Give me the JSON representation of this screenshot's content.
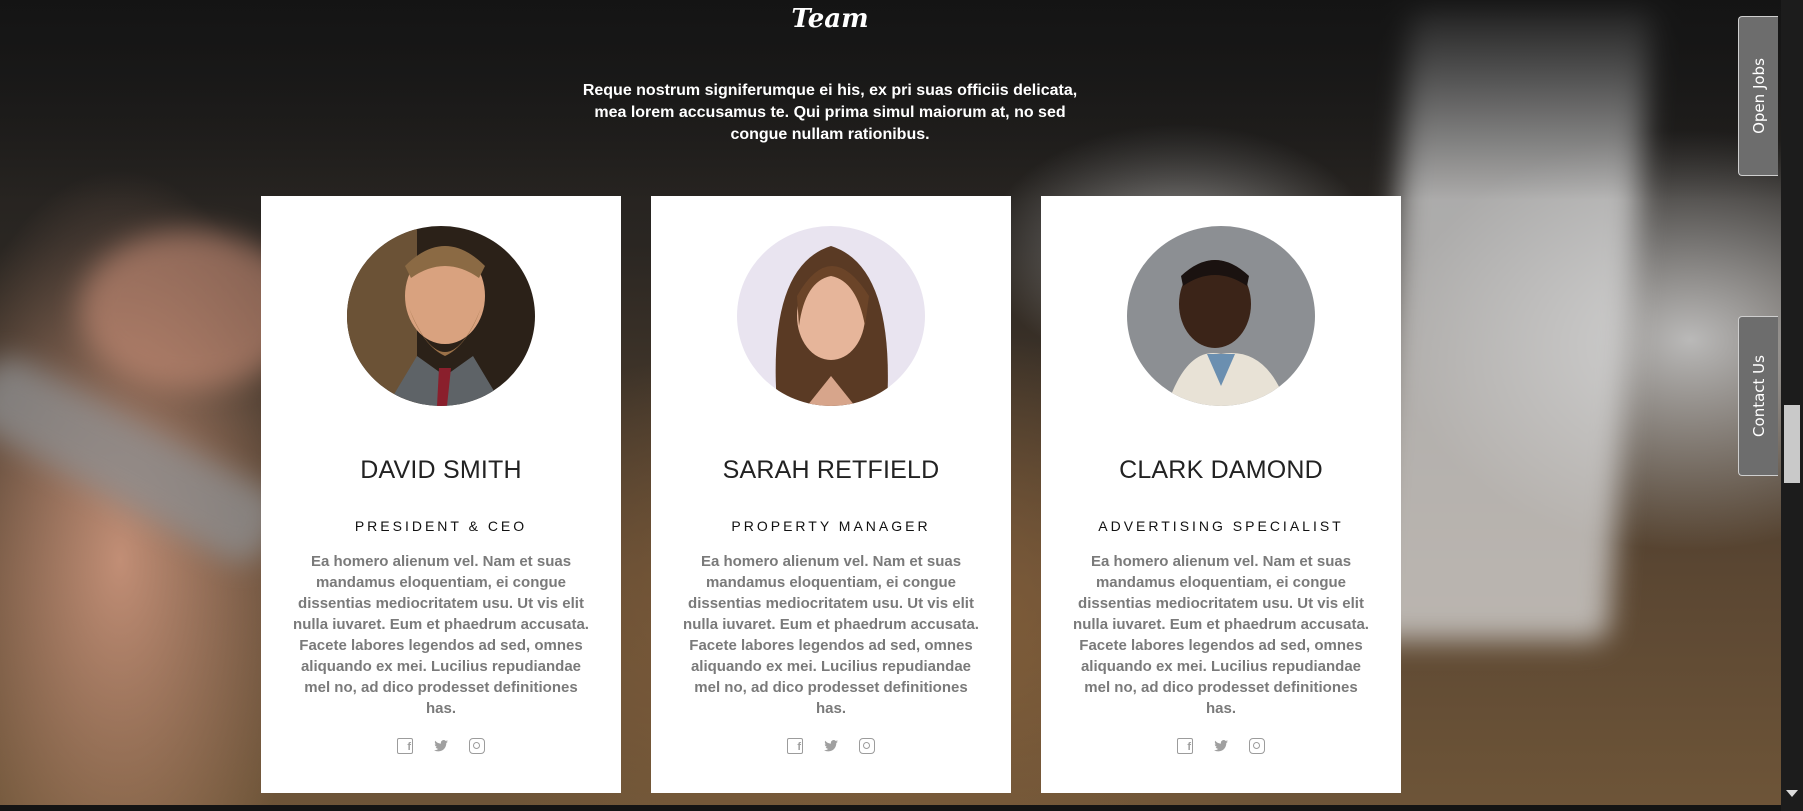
{
  "section": {
    "heading": "Team",
    "intro": "Reque nostrum signiferumque ei his, ex pri suas officiis delicata, mea lorem accusamus te. Qui prima simul maiorum at, no sed congue nullam rationibus."
  },
  "team": [
    {
      "name": "DAVID SMITH",
      "role": "PRESIDENT & CEO",
      "bio": "Ea homero alienum vel. Nam et suas mandamus eloquentiam, ei congue dissentias mediocritatem usu. Ut vis elit nulla iuvaret. Eum et phaedrum accusata. Facete labores legendos ad sed, omnes aliquando ex mei. Lucilius repudiandae mel no, ad dico prodesset definitiones has.",
      "social": [
        "facebook-icon",
        "twitter-icon",
        "instagram-icon"
      ]
    },
    {
      "name": "SARAH RETFIELD",
      "role": "PROPERTY MANAGER",
      "bio": "Ea homero alienum vel. Nam et suas mandamus eloquentiam, ei congue dissentias mediocritatem usu. Ut vis elit nulla iuvaret. Eum et phaedrum accusata. Facete labores legendos ad sed, omnes aliquando ex mei. Lucilius repudiandae mel no, ad dico prodesset definitiones has.",
      "social": [
        "facebook-icon",
        "twitter-icon",
        "instagram-icon"
      ]
    },
    {
      "name": "CLARK DAMOND",
      "role": "ADVERTISING SPECIALIST",
      "bio": "Ea homero alienum vel. Nam et suas mandamus eloquentiam, ei congue dissentias mediocritatem usu. Ut vis elit nulla iuvaret. Eum et phaedrum accusata. Facete labores legendos ad sed, omnes aliquando ex mei. Lucilius repudiandae mel no, ad dico prodesset definitiones has.",
      "social": [
        "facebook-icon",
        "twitter-icon",
        "instagram-icon"
      ]
    }
  ],
  "side_tabs": {
    "open_jobs": "Open Jobs",
    "contact_us": "Contact Us"
  },
  "colors": {
    "card_bg": "#ffffff",
    "tab_bg": "#6d6d6d",
    "bio_text": "#7a7a7a"
  }
}
